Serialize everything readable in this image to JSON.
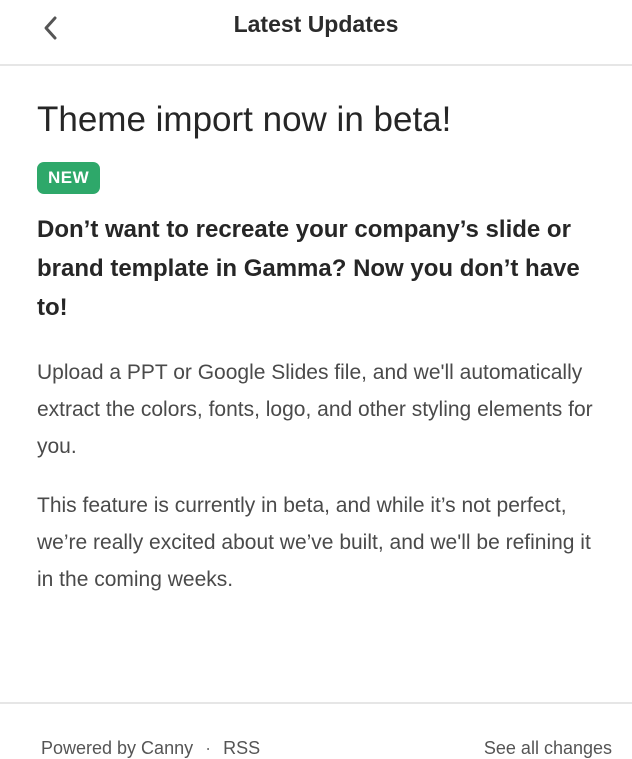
{
  "header": {
    "back_icon": "chevron-left-icon",
    "title": "Latest Updates"
  },
  "post": {
    "title": "Theme import now in beta!",
    "badge": "NEW",
    "lead": "Don’t want to recreate your company’s slide or brand template in Gamma? Now you don’t have to!",
    "paragraphs": [
      "Upload a PPT or Google Slides file, and we'll automatically extract the colors, fonts, logo, and other styling elements for you.",
      "This feature is currently in beta, and while it’s not perfect, we’re really excited about we’ve built, and we'll be refining it in the coming weeks."
    ]
  },
  "footer": {
    "powered_by": "Powered by Canny",
    "separator": "·",
    "rss": "RSS",
    "see_all": "See all changes"
  },
  "colors": {
    "badge_bg": "#2ea86a",
    "text": "#262626",
    "divider": "#e6e6e6"
  }
}
